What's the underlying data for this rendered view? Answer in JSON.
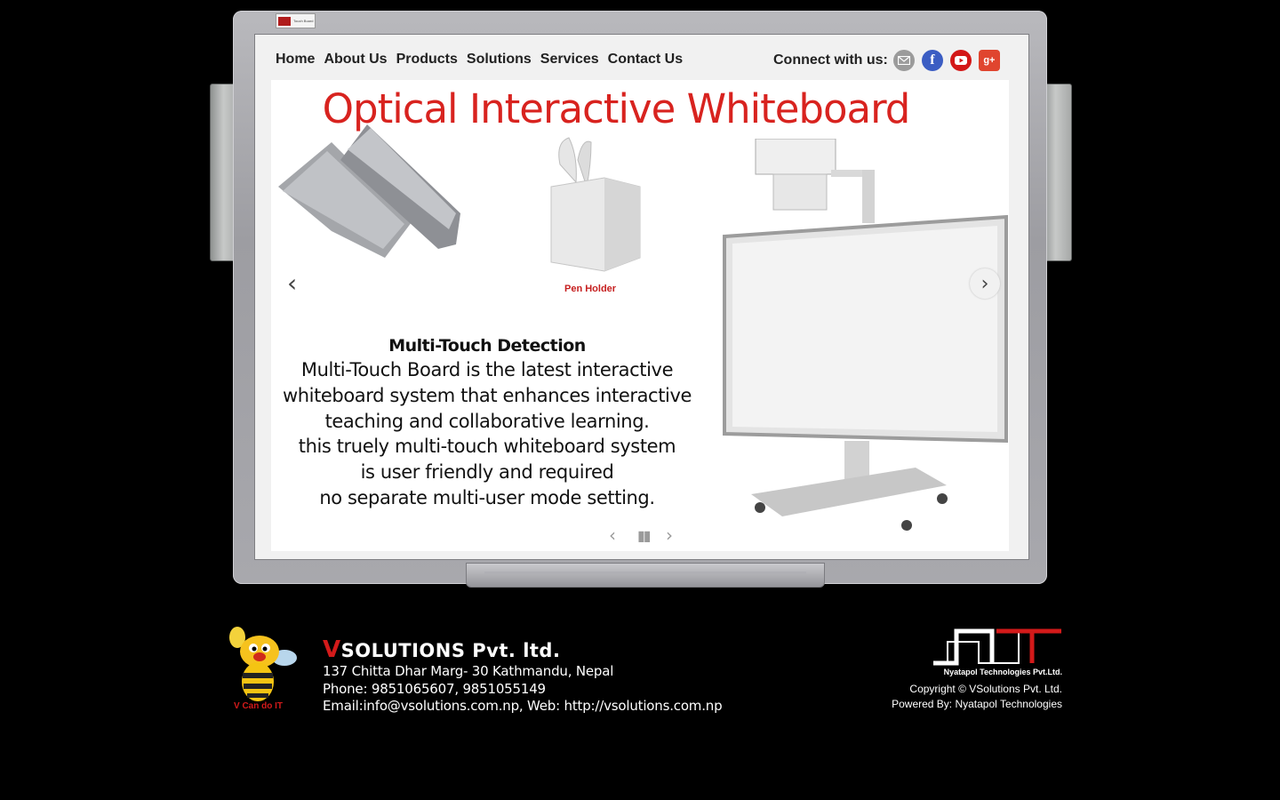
{
  "board": {
    "brand_tag": "Touch Board"
  },
  "nav": {
    "items": [
      "Home",
      "About Us",
      "Products",
      "Solutions",
      "Services",
      "Contact Us"
    ]
  },
  "connect": {
    "label": "Connect with us:",
    "icons": [
      "mail-icon",
      "facebook-icon",
      "youtube-icon",
      "google-plus-icon"
    ]
  },
  "slide": {
    "title": "Optical Interactive Whiteboard",
    "pen_caption": "Pen Holder",
    "feature_title": "Multi-Touch Detection",
    "feature_lines": [
      "Multi-Touch Board is the latest interactive",
      "whiteboard system that enhances interactive",
      "teaching and collaborative learning.",
      "this truely multi-touch whiteboard system",
      "is user friendly and required",
      "no separate multi-user mode setting."
    ]
  },
  "footer": {
    "company_v": "V",
    "company_rest": "SOLUTIONS Pvt. ltd.",
    "address": "137 Chitta Dhar Marg- 30 Kathmandu, Nepal",
    "phone": "Phone: 9851065607, 9851055149",
    "email_web": "Email:info@vsolutions.com.np, Web: http://vsolutions.com.np",
    "bee_tagline": "V Can do IT",
    "nt_name": "Nyatapol Technologies Pvt.Ltd.",
    "copyright": "Copyright © VSolutions Pvt. Ltd.",
    "powered": "Powered By: Nyatapol Technologies"
  },
  "colors": {
    "title_red": "#d8231f",
    "brand_red": "#d31a1a",
    "frame_gray": "#a8a8ad"
  }
}
